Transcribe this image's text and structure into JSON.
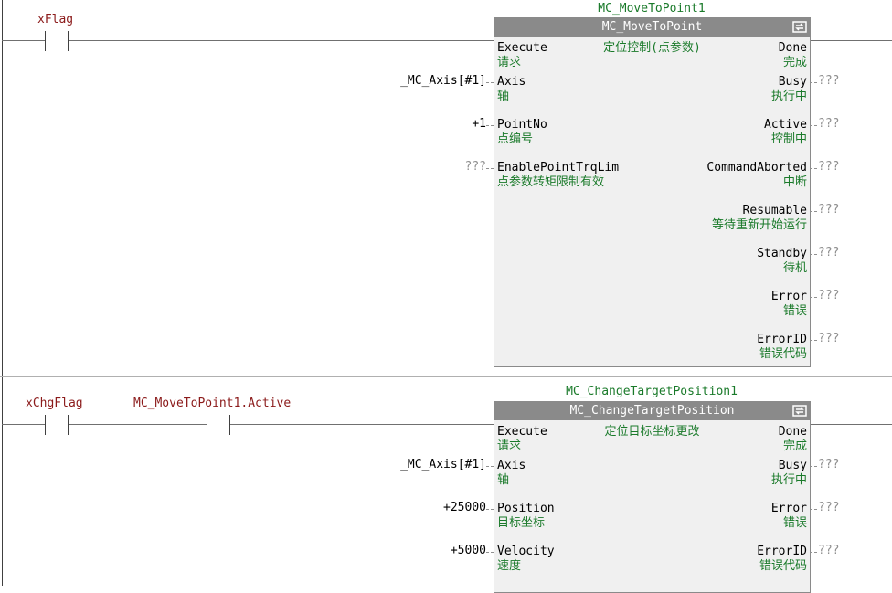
{
  "rung1": {
    "contact_var": "xFlag",
    "instance_name": "MC_MoveToPoint1",
    "fb_type": "MC_MoveToPoint",
    "fb_comment": "定位控制(点参数)",
    "inputs": [
      {
        "name": "Execute",
        "comment": "请求",
        "value": ""
      },
      {
        "name": "Axis",
        "comment": "轴",
        "value": "_MC_Axis[#1]"
      },
      {
        "name": "PointNo",
        "comment": "点编号",
        "value": "+1"
      },
      {
        "name": "EnablePointTrqLim",
        "comment": "点参数转矩限制有效",
        "value": "???"
      }
    ],
    "outputs": [
      {
        "name": "Done",
        "comment": "完成",
        "value": ""
      },
      {
        "name": "Busy",
        "comment": "执行中",
        "value": "???"
      },
      {
        "name": "Active",
        "comment": "控制中",
        "value": "???"
      },
      {
        "name": "CommandAborted",
        "comment": "中断",
        "value": "???"
      },
      {
        "name": "Resumable",
        "comment": "等待重新开始运行",
        "value": "???"
      },
      {
        "name": "Standby",
        "comment": "待机",
        "value": "???"
      },
      {
        "name": "Error",
        "comment": "错误",
        "value": "???"
      },
      {
        "name": "ErrorID",
        "comment": "错误代码",
        "value": "???"
      }
    ]
  },
  "rung2": {
    "contact_var_1": "xChgFlag",
    "contact_var_2": "MC_MoveToPoint1.Active",
    "instance_name": "MC_ChangeTargetPosition1",
    "fb_type": "MC_ChangeTargetPosition",
    "fb_comment": "定位目标坐标更改",
    "inputs": [
      {
        "name": "Execute",
        "comment": "请求",
        "value": ""
      },
      {
        "name": "Axis",
        "comment": "轴",
        "value": "_MC_Axis[#1]"
      },
      {
        "name": "Position",
        "comment": "目标坐标",
        "value": "+25000"
      },
      {
        "name": "Velocity",
        "comment": "速度",
        "value": "+5000"
      }
    ],
    "outputs": [
      {
        "name": "Done",
        "comment": "完成",
        "value": ""
      },
      {
        "name": "Busy",
        "comment": "执行中",
        "value": "???"
      },
      {
        "name": "Error",
        "comment": "错误",
        "value": "???"
      },
      {
        "name": "ErrorID",
        "comment": "错误代码",
        "value": "???"
      }
    ]
  }
}
